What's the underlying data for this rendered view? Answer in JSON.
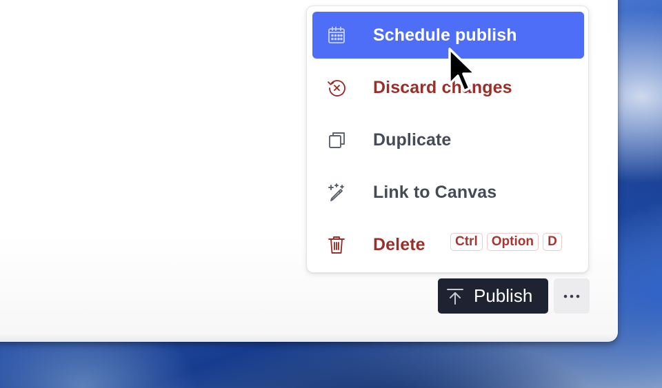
{
  "menu": {
    "items": [
      {
        "label": "Schedule publish",
        "icon": "calendar-icon",
        "state": "highlighted"
      },
      {
        "label": "Discard changes",
        "icon": "discard-icon",
        "state": "danger"
      },
      {
        "label": "Duplicate",
        "icon": "duplicate-icon",
        "state": "normal"
      },
      {
        "label": "Link to Canvas",
        "icon": "magic-pencil-icon",
        "state": "normal"
      },
      {
        "label": "Delete",
        "icon": "trash-icon",
        "state": "danger",
        "shortcut": [
          "Ctrl",
          "Option",
          "D"
        ]
      }
    ]
  },
  "toolbar": {
    "publish_label": "Publish",
    "publish_icon": "upload-arrow-icon",
    "more_icon": "more-dots-icon"
  },
  "colors": {
    "highlight": "#4f6ef7",
    "danger": "#9a2f2a",
    "neutral_text": "#454a57",
    "publish_bg": "#1f2230"
  }
}
